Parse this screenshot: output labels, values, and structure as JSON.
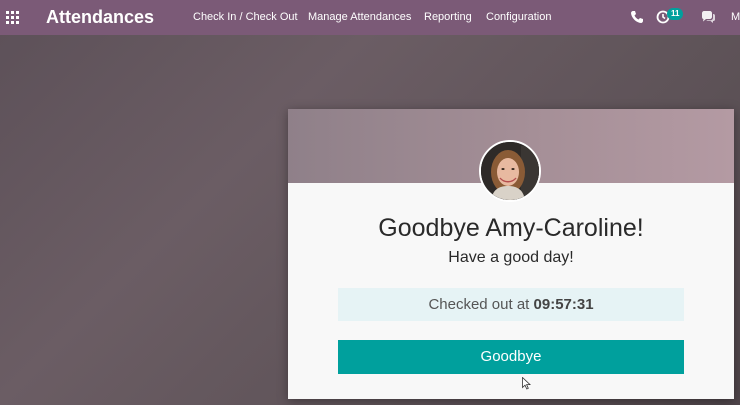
{
  "navbar": {
    "app_title": "Attendances",
    "menu": [
      "Check In / Check Out",
      "Manage Attendances",
      "Reporting",
      "Configuration"
    ],
    "activity_count": "11",
    "user_initial": "M",
    "icons": [
      "apps-grid-icon",
      "phone-icon",
      "activity-clock-icon",
      "chat-icon"
    ]
  },
  "card": {
    "greeting": "Goodbye Amy-Caroline!",
    "subgreeting": "Have a good day!",
    "checkout_label": "Checked out at",
    "checkout_time": "09:57:31",
    "button_label": "Goodbye"
  },
  "colors": {
    "navbar": "#7b5a77",
    "accent": "#00a09d",
    "checkout_bg": "#e6f3f5"
  }
}
